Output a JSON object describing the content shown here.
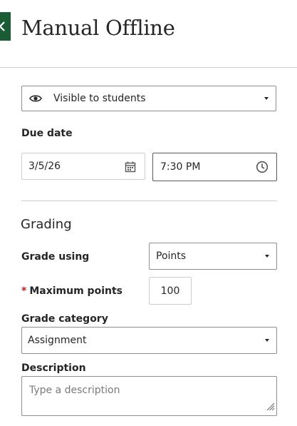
{
  "header": {
    "title": "Manual Offline"
  },
  "visibility": {
    "value": "Visible to students",
    "icon": "eye-icon"
  },
  "due_date": {
    "label": "Due date",
    "date_value": "3/5/26",
    "time_value": "7:30 PM",
    "date_icon": "calendar-icon",
    "time_icon": "clock-icon"
  },
  "grading": {
    "heading": "Grading",
    "grade_using_label": "Grade using",
    "grade_using_value": "Points",
    "required_marker": "*",
    "max_points_label": "Maximum points",
    "max_points_value": "100",
    "category_label": "Grade category",
    "category_value": "Assignment",
    "description_label": "Description",
    "description_placeholder": "Type a description"
  },
  "colors": {
    "brand_green": "#1a5c36",
    "required_red": "#c41a1a",
    "text": "#262626",
    "border": "#8f8f8f"
  }
}
